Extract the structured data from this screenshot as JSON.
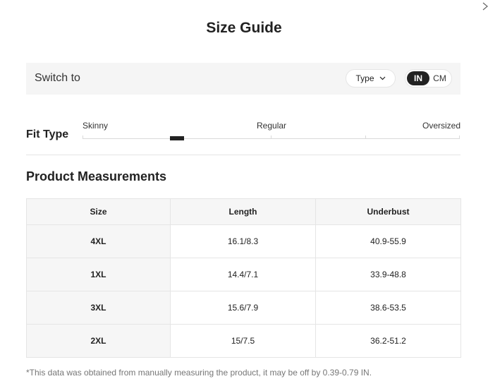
{
  "title": "Size Guide",
  "switch_bar": {
    "label": "Switch to",
    "type_dropdown_label": "Type",
    "units": [
      {
        "label": "IN",
        "active": true
      },
      {
        "label": "CM",
        "active": false
      }
    ]
  },
  "fit_type": {
    "label": "Fit Type",
    "options": [
      "Skinny",
      "Regular",
      "Oversized"
    ],
    "selected_position": 0.25
  },
  "measurements": {
    "title": "Product Measurements",
    "headers": [
      "Size",
      "Length",
      "Underbust"
    ],
    "rows": [
      [
        "4XL",
        "16.1/8.3",
        "40.9-55.9"
      ],
      [
        "1XL",
        "14.4/7.1",
        "33.9-48.8"
      ],
      [
        "3XL",
        "15.6/7.9",
        "38.6-53.5"
      ],
      [
        "2XL",
        "15/7.5",
        "36.2-51.2"
      ]
    ]
  },
  "note": "*This data was obtained from manually measuring the product, it may be off by 0.39-0.79 IN.",
  "icons": {
    "close": "close-icon",
    "dropdown": "chevron-down-icon"
  },
  "colors": {
    "accent": "#222222",
    "panel": "#f5f5f5",
    "border": "#e5e5e5",
    "muted_text": "#767676"
  }
}
